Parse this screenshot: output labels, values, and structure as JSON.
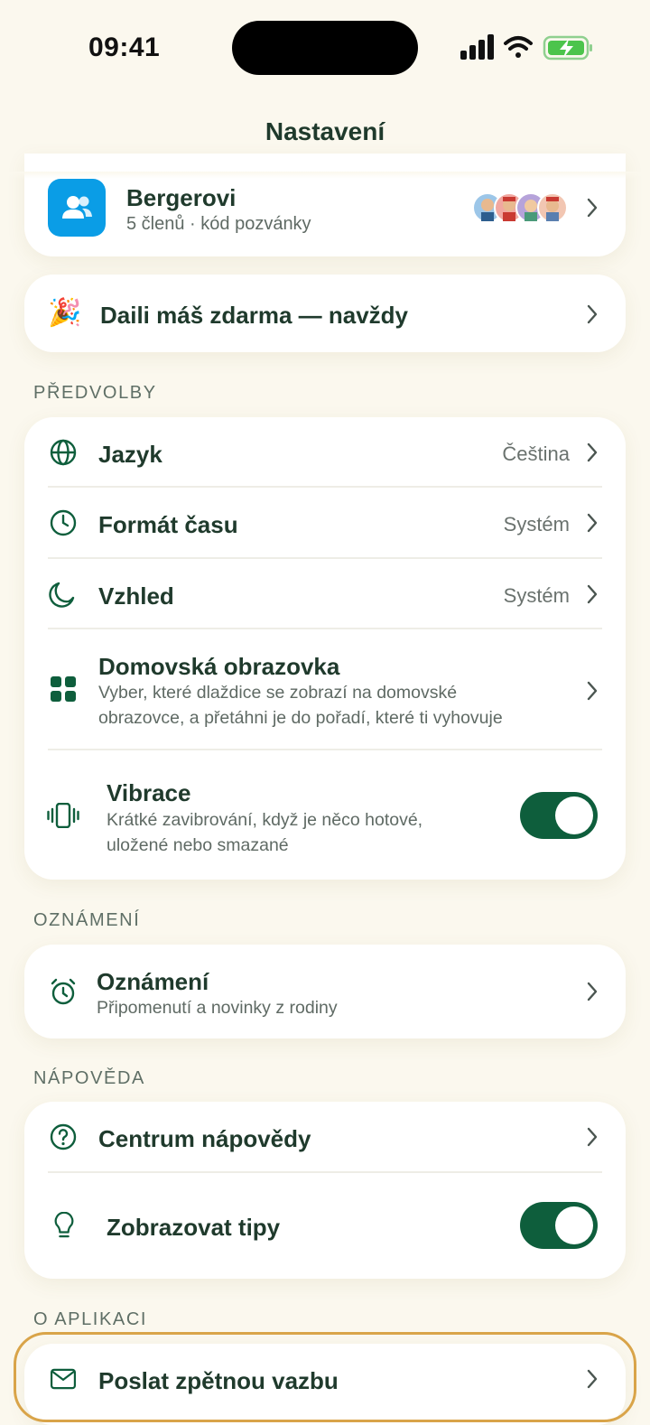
{
  "status_bar": {
    "time": "09:41"
  },
  "nav": {
    "title": "Nastavení"
  },
  "family": {
    "name": "Bergerovi",
    "subtitle": "5 členů · kód pozvánky"
  },
  "promo": {
    "emoji": "🎉",
    "label": "Daili máš zdarma — navždy"
  },
  "sections": {
    "preferences": "PŘEDVOLBY",
    "notifications": "OZNÁMENÍ",
    "help": "NÁPOVĚDA",
    "about": "O APLIKACI"
  },
  "preferences": {
    "language": {
      "label": "Jazyk",
      "value": "Čeština"
    },
    "time_format": {
      "label": "Formát času",
      "value": "Systém"
    },
    "appearance": {
      "label": "Vzhled",
      "value": "Systém"
    },
    "home_screen": {
      "label": "Domovská obrazovka",
      "desc_line1": "Vyber, které dlaždice se zobrazí na domovské",
      "desc_line2": "obrazovce, a přetáhni je do pořadí, které ti vyhovuje"
    },
    "vibration": {
      "label": "Vibrace",
      "desc_line1": "Krátké zavibrování, když je něco hotové,",
      "desc_line2": "uložené nebo smazané",
      "enabled": true
    }
  },
  "notifications": {
    "label": "Oznámení",
    "desc": "Připomenutí a novinky z rodiny"
  },
  "help": {
    "center": {
      "label": "Centrum nápovědy"
    },
    "tips": {
      "label": "Zobrazovat tipy",
      "enabled": true
    }
  },
  "about": {
    "feedback": {
      "label": "Poslat zpětnou vazbu"
    }
  },
  "colors": {
    "background": "#FBF8EE",
    "accent": "#0E5E3C",
    "family_icon_bg": "#0A9DE6",
    "highlight_border": "#D9A449"
  }
}
